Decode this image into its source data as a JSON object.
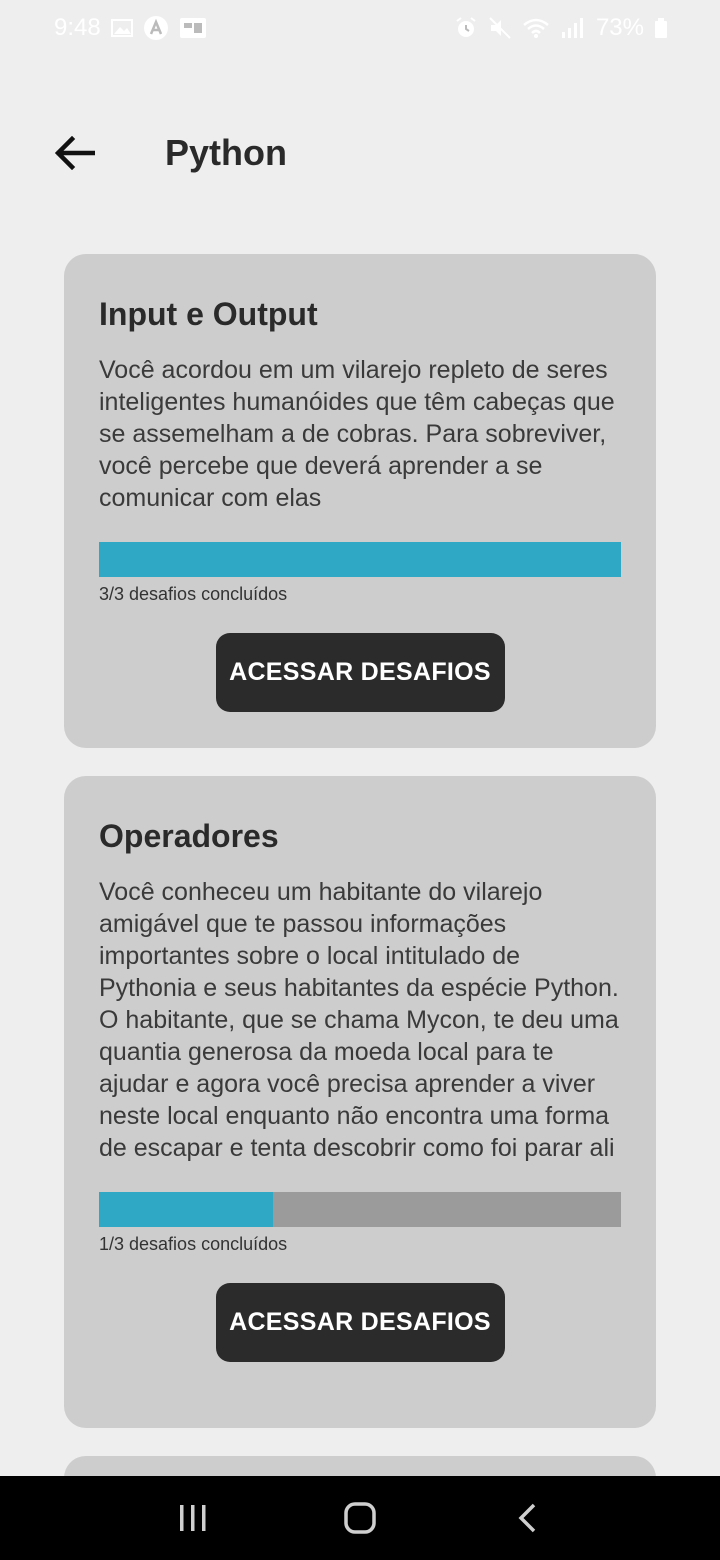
{
  "status_bar": {
    "time": "9:48",
    "battery": "73%",
    "left_icons": [
      "image-icon",
      "app-a-icon",
      "app-badge-icon"
    ],
    "right_icons": [
      "alarm-icon",
      "mute-icon",
      "wifi-icon",
      "signal-icon",
      "battery-icon"
    ]
  },
  "header": {
    "title": "Python",
    "back_icon": "arrow-left-icon"
  },
  "cards": [
    {
      "title": "Input e Output",
      "description": "Você acordou em um vilarejo repleto de seres inteligentes humanóides que têm cabeças que se assemelham a de cobras. Para sobreviver, você percebe que deverá aprender a se comunicar com elas",
      "progress": 1.0,
      "progress_text": "3/3 desafios concluídos",
      "button_label": "ACESSAR DESAFIOS"
    },
    {
      "title": "Operadores",
      "description": "Você conheceu um habitante do vilarejo amigável que te passou informações importantes sobre o local intitulado de Pythonia e seus habitantes da espécie Python. O habitante, que se chama Mycon, te deu uma quantia generosa da moeda local para te ajudar e agora você precisa aprender a viver neste local enquanto não encontra uma forma de escapar e tenta descobrir como foi parar ali",
      "progress": 0.3333,
      "progress_text": "1/3 desafios concluídos",
      "button_label": "ACESSAR DESAFIOS"
    }
  ],
  "colors": {
    "background": "#eeeeee",
    "card": "#cdcdcd",
    "progress_fill": "#2fa8c5",
    "progress_track": "#9b9b9b",
    "button": "#2b2b2b"
  },
  "nav_bar": {
    "icons": [
      "recent-apps-icon",
      "home-icon",
      "back-icon"
    ]
  }
}
